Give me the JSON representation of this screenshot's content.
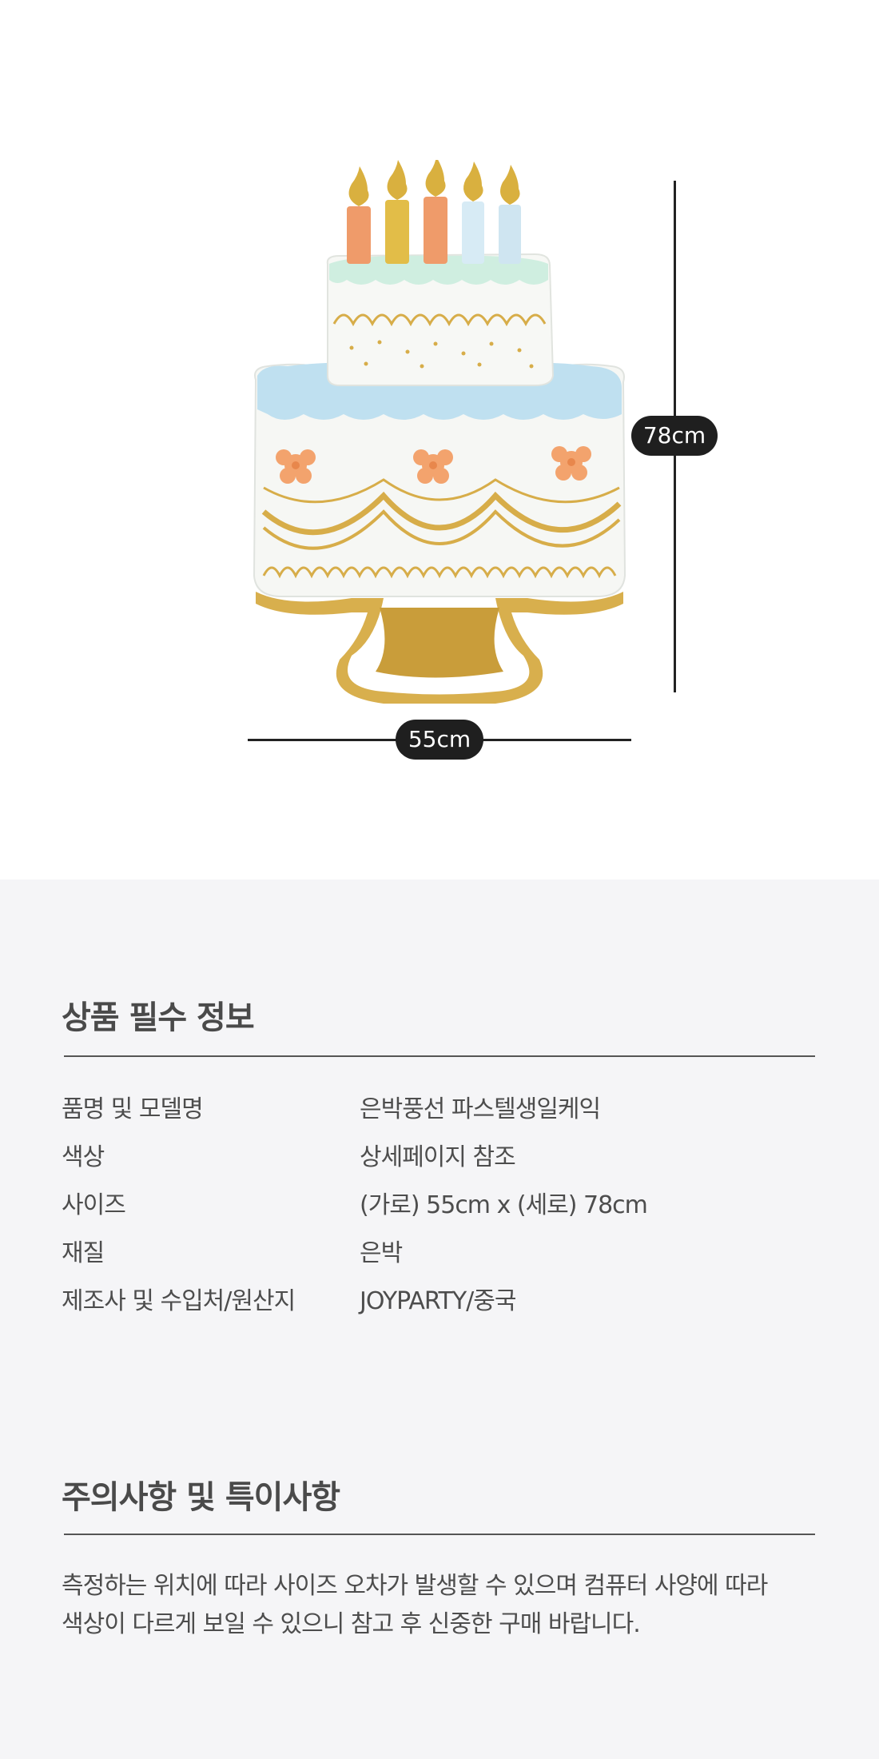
{
  "product": {
    "image_alt": "은박풍선 파스텔생일케익",
    "height_label": "78cm",
    "width_label": "55cm"
  },
  "spec_section": {
    "title": "상품 필수 정보",
    "rows": [
      {
        "label": "품명 및 모델명",
        "value": "은박풍선 파스텔생일케익"
      },
      {
        "label": "색상",
        "value": "상세페이지 참조"
      },
      {
        "label": "사이즈",
        "value": "(가로) 55cm x (세로) 78cm"
      },
      {
        "label": "재질",
        "value": "은박"
      },
      {
        "label": "제조사 및 수입처/원산지",
        "value": "JOYPARTY/중국"
      }
    ]
  },
  "notice_section": {
    "title": "주의사항 및 특이사항",
    "lines": [
      "측정하는 위치에 따라 사이즈 오차가 발생할 수 있으며 컴퓨터 사양에 따라",
      "색상이 다르게 보일 수 있으니 참고 후 신중한 구매 바랍니다."
    ]
  },
  "colors": {
    "background_top": "#ffffff",
    "background_info": "#f5f5f7",
    "pill": "#1f1f1f",
    "gold": "#d7ad49",
    "pastel_blue": "#bfe0f0",
    "mint": "#cfeee0",
    "peach": "#f3a36d"
  }
}
